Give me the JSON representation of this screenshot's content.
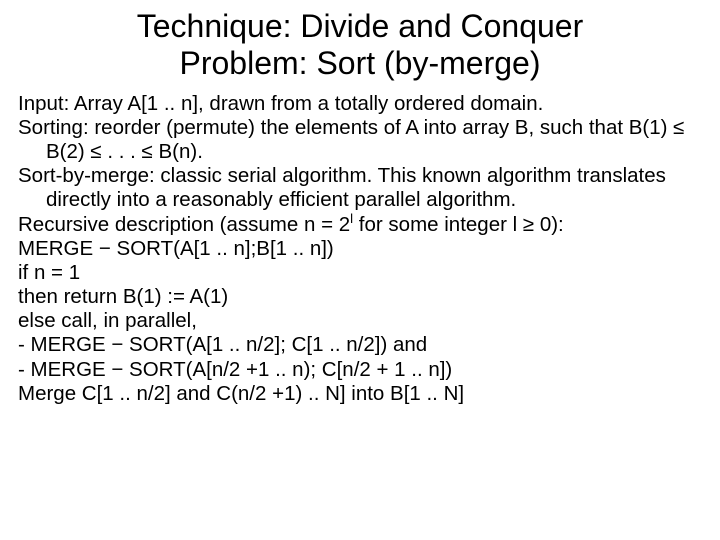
{
  "title_line1": "Technique: Divide and Conquer",
  "title_line2": "Problem: Sort (by-merge)",
  "lines": {
    "l0": "Input: Array A[1 .. n], drawn from a totally ordered domain.",
    "l1": "Sorting: reorder (permute) the elements of A into array B, such that B(1) ≤ B(2) ≤ . . . ≤ B(n).",
    "l2": "Sort-by-merge: classic serial algorithm. This known algorithm translates directly into a reasonably efficient parallel algorithm.",
    "l3a": "Recursive description (assume n = 2",
    "l3sup": "l",
    "l3b": " for some integer l ≥ 0):",
    "l4": "MERGE − SORT(A[1 .. n];B[1 .. n])",
    "l5": "if n = 1",
    "l6": "then return B(1) := A(1)",
    "l7": "else call, in parallel,",
    "l8": "- MERGE − SORT(A[1 .. n/2]; C[1 .. n/2]) and",
    "l9": "- MERGE − SORT(A[n/2 +1 .. n); C[n/2 + 1 .. n])",
    "l10": "Merge C[1 .. n/2] and C(n/2 +1) .. N] into B[1 .. N]"
  }
}
